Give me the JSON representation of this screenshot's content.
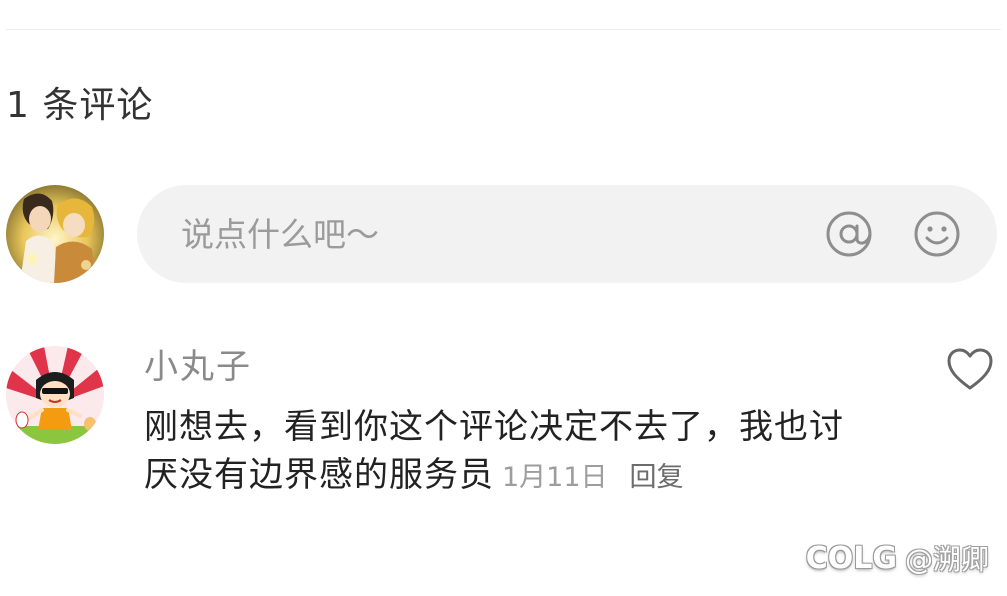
{
  "comments_header": {
    "count_label": "1 条评论"
  },
  "composer": {
    "placeholder": "说点什么吧～",
    "avatar": "user-avatar",
    "mention_icon": "at-icon",
    "emoji_icon": "smiley-icon"
  },
  "comments": [
    {
      "username": "小丸子",
      "avatar": "cartoon-avatar",
      "text": "刚想去，看到你这个评论决定不去了，我也讨厌没有边界感的服务员",
      "date": "1月11日",
      "reply_label": "回复",
      "like_icon": "heart-icon"
    }
  ],
  "watermark": {
    "logo": "COLG",
    "handle": "@溯卿"
  },
  "colors": {
    "input_background": "#f2f2f2",
    "username": "#8a8a8a",
    "meta": "#9d9d9d"
  }
}
